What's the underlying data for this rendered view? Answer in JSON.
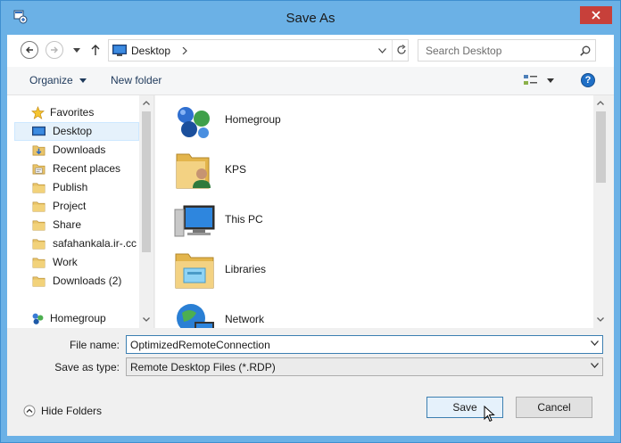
{
  "window": {
    "title": "Save As"
  },
  "nav": {
    "address": "Desktop",
    "search_placeholder": "Search Desktop"
  },
  "toolbar": {
    "organize_label": "Organize",
    "new_folder_label": "New folder"
  },
  "sidebar": {
    "favorites_label": "Favorites",
    "items": [
      {
        "label": "Desktop",
        "icon": "desktop-icon"
      },
      {
        "label": "Downloads",
        "icon": "downloads-icon"
      },
      {
        "label": "Recent places",
        "icon": "recent-places-icon"
      },
      {
        "label": "Publish",
        "icon": "folder-icon"
      },
      {
        "label": "Project",
        "icon": "folder-icon"
      },
      {
        "label": "Share",
        "icon": "folder-icon"
      },
      {
        "label": "safahankala.ir-.cc",
        "icon": "folder-icon"
      },
      {
        "label": "Work",
        "icon": "folder-icon"
      },
      {
        "label": "Downloads (2)",
        "icon": "folder-icon"
      }
    ],
    "homegroup_label": "Homegroup"
  },
  "content": {
    "items": [
      {
        "label": "Homegroup",
        "icon": "homegroup-icon"
      },
      {
        "label": "KPS",
        "icon": "user-folder-icon"
      },
      {
        "label": "This PC",
        "icon": "this-pc-icon"
      },
      {
        "label": "Libraries",
        "icon": "libraries-icon"
      },
      {
        "label": "Network",
        "icon": "network-icon"
      }
    ]
  },
  "form": {
    "file_name_label": "File name:",
    "file_name_value": "OptimizedRemoteConnection",
    "save_type_label": "Save as type:",
    "save_type_value": "Remote Desktop Files (*.RDP)"
  },
  "footer": {
    "hide_folders_label": "Hide Folders",
    "save_label": "Save",
    "cancel_label": "Cancel"
  }
}
